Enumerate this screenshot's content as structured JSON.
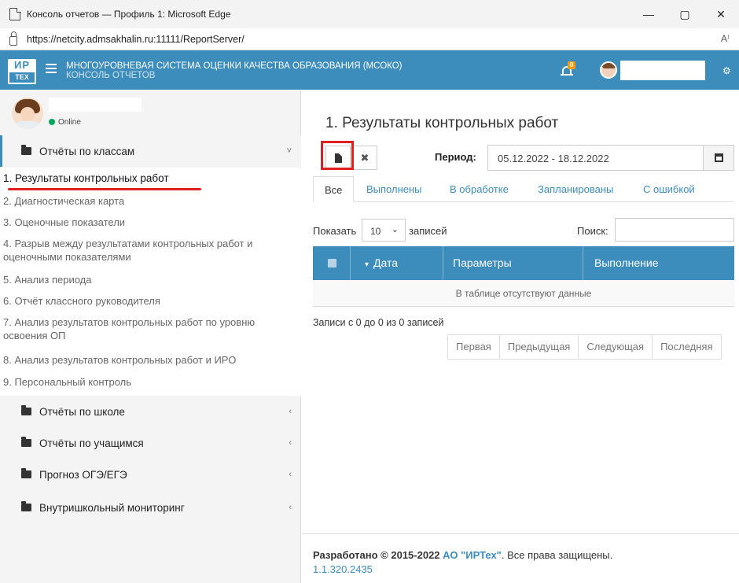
{
  "browser": {
    "window_title": "Консоль отчетов — Профиль 1: Microsoft Edge",
    "url": "https://netcity.admsakhalin.ru:11111/ReportServer/",
    "minimize": "—",
    "maximize": "▢",
    "close": "✕",
    "read_aloud": "A⁾"
  },
  "header": {
    "logo_top": "ИР",
    "logo_bottom": "ТЕХ",
    "title": "МНОГОУРОВНЕВАЯ СИСТЕМА ОЦЕНКИ КАЧЕСТВА ОБРАЗОВАНИЯ (МСОКО)",
    "subtitle": "КОНСОЛЬ ОТЧЕТОВ",
    "notification_count": "0",
    "settings_icon": "gears-icon",
    "accent_color": "#3c8dbc"
  },
  "sidebar": {
    "status": "Online",
    "sections": [
      {
        "label": "Отчёты по классам",
        "icon": "folder-open-icon",
        "chevron": "˅"
      },
      {
        "label": "Отчёты по школе",
        "icon": "folder-open-icon",
        "chevron": "‹"
      },
      {
        "label": "Отчёты по учащимся",
        "icon": "folder-open-icon",
        "chevron": "‹"
      },
      {
        "label": "Прогноз ОГЭ/ЕГЭ",
        "icon": "folder-open-icon",
        "chevron": "‹"
      },
      {
        "label": "Внутришкольный мониторинг",
        "icon": "folder-open-icon",
        "chevron": "‹"
      }
    ],
    "items": [
      "1. Результаты контрольных работ",
      "2. Диагностическая карта",
      "3. Оценочные показатели",
      "4. Разрыв между результатами контрольных работ и оценочными показателями",
      "5. Анализ периода",
      "6. Отчёт классного руководителя",
      "7. Анализ результатов контрольных работ по уровню освоения ОП",
      "8. Анализ результатов контрольных работ и ИРО",
      "9. Персональный контроль"
    ]
  },
  "main": {
    "page_title": "1. Результаты контрольных работ",
    "period_label": "Период:",
    "period_value": "05.12.2022 - 18.12.2022",
    "tabs": [
      "Все",
      "Выполнены",
      "В обработке",
      "Запланированы",
      "С ошибкой"
    ],
    "show_label": "Показать",
    "page_size": "10",
    "entries_label": "записей",
    "search_label": "Поиск:",
    "table": {
      "columns": [
        "Дата",
        "Параметры",
        "Выполнение"
      ],
      "sort_indicator": "▾",
      "empty_message": "В таблице отсутствуют данные"
    },
    "info": "Записи с 0 до 0 из 0 записей",
    "pager": [
      "Первая",
      "Предыдущая",
      "Следующая",
      "Последняя"
    ]
  },
  "footer": {
    "developed_prefix": "Разработано © 2015-2022",
    "company": "АО \"ИРТех\"",
    "rights": ". Все права защищены.",
    "version": "1.1.320.2435"
  }
}
